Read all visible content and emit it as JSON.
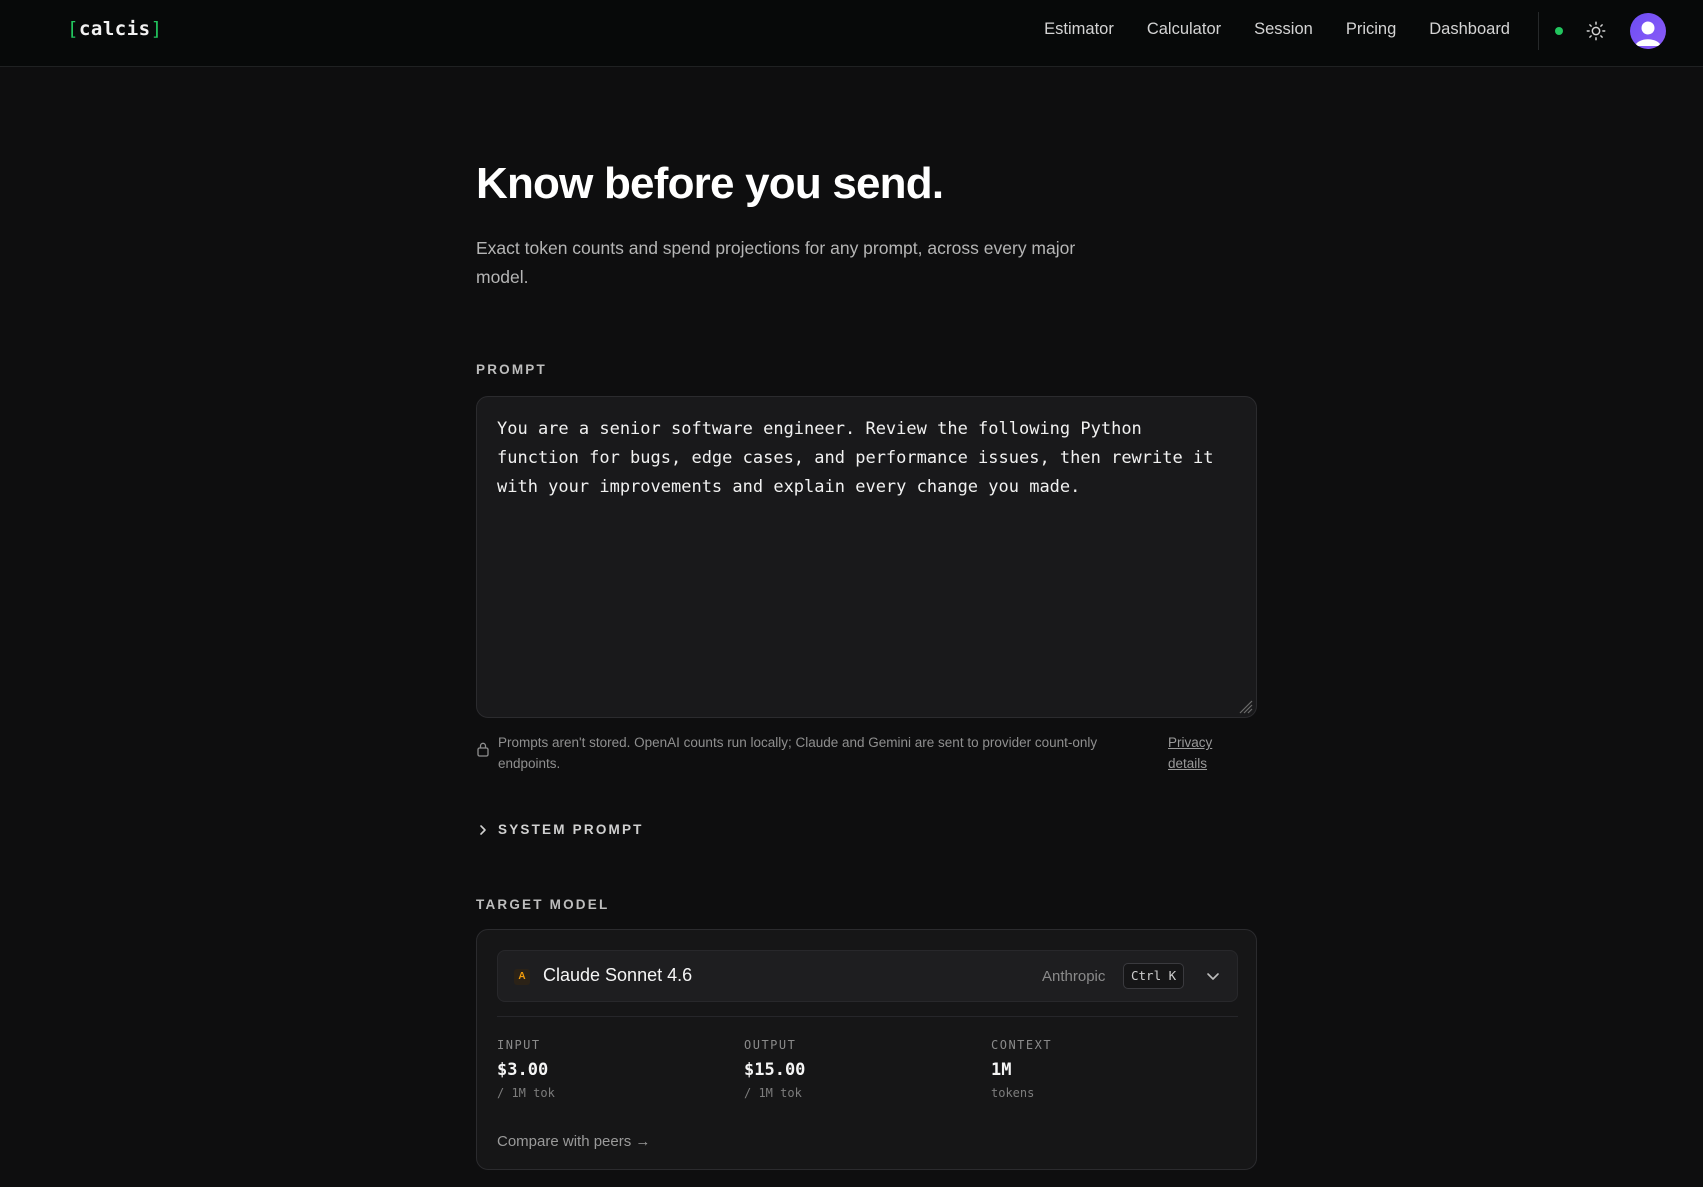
{
  "header": {
    "logo_open": "[",
    "logo_text": "calcis",
    "logo_close": "]",
    "nav": [
      {
        "label": "Estimator"
      },
      {
        "label": "Calculator"
      },
      {
        "label": "Session"
      },
      {
        "label": "Pricing"
      },
      {
        "label": "Dashboard"
      }
    ],
    "status_color": "#22c55e",
    "theme_icon": "sun-icon",
    "avatar_icon": "user-avatar-icon"
  },
  "hero": {
    "title": "Know before you send.",
    "subtitle": "Exact token counts and spend projections for any prompt, across every major model."
  },
  "prompt": {
    "label": "PROMPT",
    "value": "You are a senior software engineer. Review the following Python\nfunction for bugs, edge cases, and performance issues, then rewrite it\nwith your improvements and explain every change you made."
  },
  "privacy": {
    "text": "Prompts aren't stored. OpenAI counts run locally; Claude and Gemini are sent to provider count-only endpoints.",
    "link": "Privacy details"
  },
  "system_prompt": {
    "label": "SYSTEM PROMPT"
  },
  "target_model": {
    "label": "TARGET MODEL",
    "provider_badge": "A",
    "model_name": "Claude Sonnet 4.6",
    "provider": "Anthropic",
    "shortcut": "Ctrl K",
    "accent": "#f59e0b",
    "stats": [
      {
        "label": "INPUT",
        "value": "$3.00",
        "unit": "/ 1M tok"
      },
      {
        "label": "OUTPUT",
        "value": "$15.00",
        "unit": "/ 1M tok"
      },
      {
        "label": "CONTEXT",
        "value": "1M",
        "unit": "tokens"
      }
    ],
    "compare_link": "Compare with peers →"
  }
}
